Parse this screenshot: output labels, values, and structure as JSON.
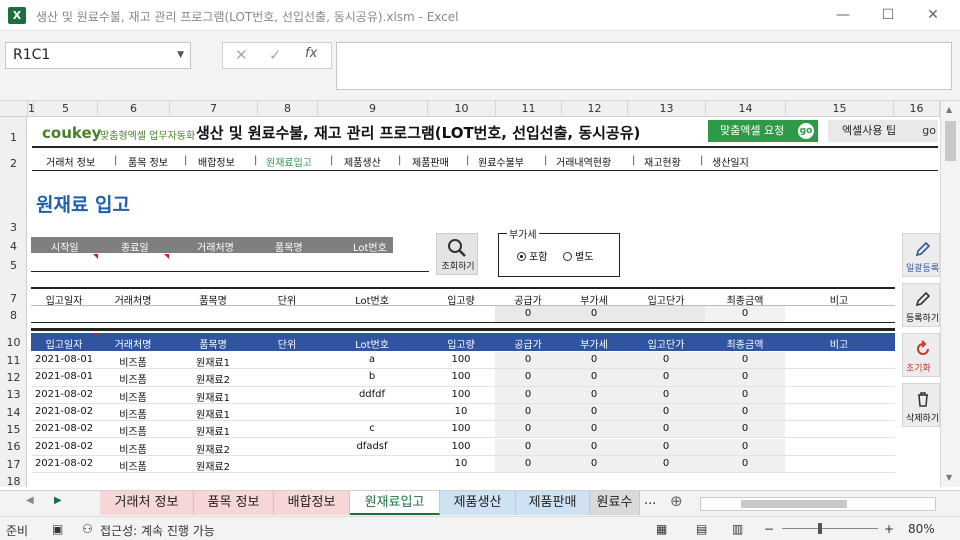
{
  "window": {
    "title": "생산 및 원료수불, 재고 관리 프로그램(LOT번호, 선입선출, 동시공유).xlsm  -  Excel",
    "logo": "X"
  },
  "formula_bar": {
    "name_box": "R1C1",
    "fx": "fx",
    "value": ""
  },
  "columns": [
    "1",
    "5",
    "6",
    "7",
    "8",
    "9",
    "10",
    "11",
    "12",
    "13",
    "14",
    "15",
    "16"
  ],
  "rows": [
    "1",
    "2",
    "3",
    "4",
    "5",
    "7",
    "8",
    "10",
    "11",
    "12",
    "13",
    "14",
    "15",
    "16",
    "17",
    "18"
  ],
  "banner": {
    "brand": "coukey",
    "brand_sub": "맞춤형엑셀 업무자동화",
    "title": "생산 및 원료수불, 재고 관리 프로그램(LOT번호, 선입선출, 동시공유)",
    "custom_button": "맞춤엑셀 요청",
    "custom_go": "go",
    "tips_button": "엑셀사용 팁",
    "tips_go": "go"
  },
  "menu": [
    "거래처 정보",
    "품목 정보",
    "배합정보",
    "원재료입고",
    "제품생산",
    "제품판매",
    "원료수불부",
    "거래내역현황",
    "재고현황",
    "생산일지"
  ],
  "menu_active_index": 3,
  "page_title": "원재료 입고",
  "filter": {
    "headers": [
      "시작일",
      "종료일",
      "거래처명",
      "품목명",
      "Lot번호"
    ],
    "search_label": "조회하기"
  },
  "tax": {
    "legend": "부가세",
    "options": [
      "포함",
      "별도"
    ],
    "selected": 0
  },
  "input_form": {
    "headers": [
      "입고일자",
      "거래처명",
      "품목명",
      "단위",
      "Lot번호",
      "입고량",
      "공급가",
      "부가세",
      "입고단가",
      "최종금액",
      "비고"
    ],
    "values": [
      "",
      "",
      "",
      "",
      "",
      "",
      "0",
      "0",
      "",
      "0",
      ""
    ]
  },
  "list": {
    "headers": [
      "입고일자",
      "거래처명",
      "품목명",
      "단위",
      "Lot번호",
      "입고량",
      "공급가",
      "부가세",
      "입고단가",
      "최종금액",
      "비고"
    ],
    "rows": [
      [
        "2021-08-01",
        "비즈폼",
        "원재료1",
        "",
        "a",
        "100",
        "0",
        "0",
        "0",
        "0",
        ""
      ],
      [
        "2021-08-01",
        "비즈폼",
        "원재료2",
        "",
        "b",
        "100",
        "0",
        "0",
        "0",
        "0",
        ""
      ],
      [
        "2021-08-02",
        "비즈폼",
        "원재료1",
        "",
        "ddfdf",
        "100",
        "0",
        "0",
        "0",
        "0",
        ""
      ],
      [
        "2021-08-02",
        "비즈폼",
        "원재료1",
        "",
        "",
        "10",
        "0",
        "0",
        "0",
        "0",
        ""
      ],
      [
        "2021-08-02",
        "비즈폼",
        "원재료1",
        "",
        "c",
        "100",
        "0",
        "0",
        "0",
        "0",
        ""
      ],
      [
        "2021-08-02",
        "비즈폼",
        "원재료2",
        "",
        "dfadsf",
        "100",
        "0",
        "0",
        "0",
        "0",
        ""
      ],
      [
        "2021-08-02",
        "비즈폼",
        "원재료2",
        "",
        "",
        "10",
        "0",
        "0",
        "0",
        "0",
        ""
      ]
    ]
  },
  "side_buttons": [
    "일괄등록",
    "등록하기",
    "초기화",
    "삭제하기"
  ],
  "tabs": [
    "거래처 정보",
    "품목 정보",
    "배합정보",
    "원재료입고",
    "제품생산",
    "제품판매",
    "원료수"
  ],
  "tabs_active_index": 3,
  "tabs_more": "...",
  "status": {
    "ready": "준비",
    "accessibility": "접근성: 계속 진행 가능",
    "zoom": "80%"
  },
  "colors": {
    "excel_green": "#1d6f42",
    "accent_green": "#2e9a48",
    "header_blue": "#2f54a0",
    "title_blue": "#1f5fae"
  }
}
